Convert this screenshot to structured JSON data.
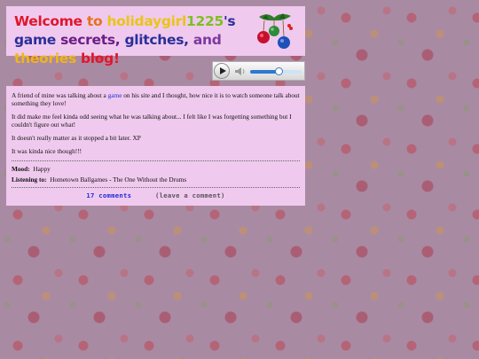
{
  "banner": {
    "title_parts": [
      {
        "text": "Welcome ",
        "color": "#e0162b"
      },
      {
        "text": "to ",
        "color": "#e4731a"
      },
      {
        "text": "holidaygirl",
        "color": "#e9c516"
      },
      {
        "text": "1225",
        "color": "#7cc11f"
      },
      {
        "text": "'s game ",
        "color": "#2a2f9a"
      },
      {
        "text": "secrets, ",
        "color": "#6a1e86"
      },
      {
        "text": "glitches, ",
        "color": "#2a2f9a"
      },
      {
        "text": "and ",
        "color": "#7a3aa0"
      },
      {
        "text": "theories ",
        "color": "#efb51a"
      },
      {
        "text": "blog!",
        "color": "#e0162b"
      }
    ],
    "ornament_icon": "christmas-ornaments-icon"
  },
  "player": {
    "play_icon": "play-icon",
    "volume_icon": "speaker-icon",
    "progress": 0.55
  },
  "post": {
    "p1_before": "A friend of mine was talking about a ",
    "p1_link": "game",
    "p1_after": " on his site and I thought, how nice it is to watch someone talk about something they love!",
    "p2": "It did make me feel kinda odd seeing what he was talking about... I felt like I was forgetting something but I couldn't figure out what!",
    "p3": "It doesn't really matter as it stopped a bit later. XP",
    "p4": "It was kinda nice though!!!",
    "mood_label": "Mood:",
    "mood_value": "Happy",
    "listening_label": "Listening to:",
    "listening_value": "Hometown Ballgames - The One Without the Drums",
    "comments_link": "17 comments",
    "leave_comment_link": "(leave a comment)"
  },
  "colors": {
    "panel": "#f0c9ee",
    "link": "#1f2bd9",
    "page_background": "#a98aa3"
  }
}
